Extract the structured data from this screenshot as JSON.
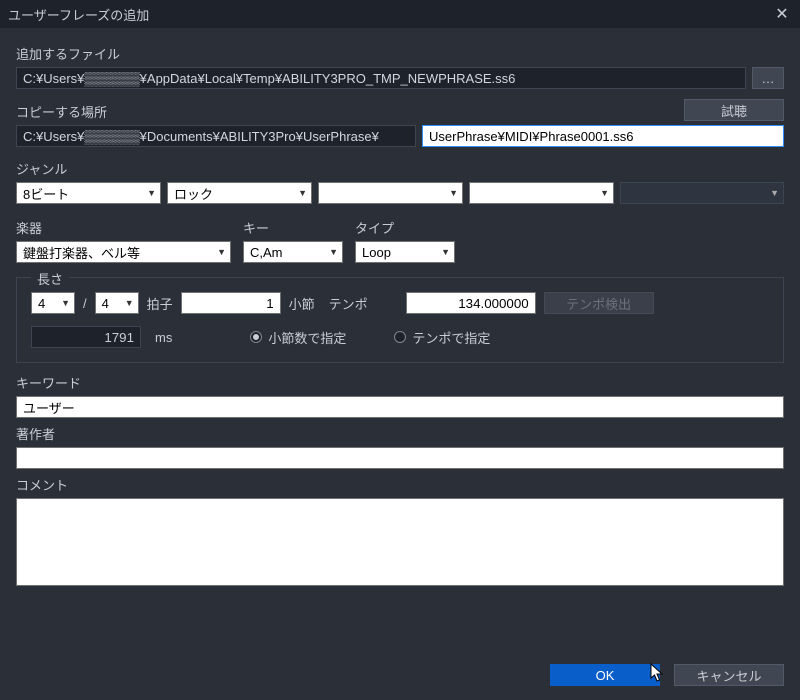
{
  "window": {
    "title": "ユーザーフレーズの追加"
  },
  "file_add": {
    "label": "追加するファイル",
    "path": "C:¥Users¥▒▒▒▒▒▒¥AppData¥Local¥Temp¥ABILITY3PRO_TMP_NEWPHRASE.ss6",
    "browse": "…"
  },
  "copy_to": {
    "label": "コピーする場所",
    "audition": "試聴",
    "base_path": "C:¥Users¥▒▒▒▒▒▒¥Documents¥ABILITY3Pro¥UserPhrase¥",
    "rel_path": "UserPhrase¥MIDI¥Phrase0001.ss6"
  },
  "genre": {
    "label": "ジャンル",
    "selects": [
      "8ビート",
      "ロック",
      "",
      "",
      ""
    ]
  },
  "instrument": {
    "label": "楽器",
    "value": "鍵盤打楽器、ベル等"
  },
  "key_field": {
    "label": "キー",
    "value": "C,Am"
  },
  "type_field": {
    "label": "タイプ",
    "value": "Loop"
  },
  "length": {
    "legend": "長さ",
    "beats1": "4",
    "slash": "/",
    "beats2": "4",
    "beat_label": "拍子",
    "bars": "1",
    "bar_label": "小節",
    "tempo_label": "テンポ",
    "tempo": "134.000000",
    "detect": "テンポ検出",
    "ms_value": "1791",
    "ms_label": "ms",
    "radio_bars": "小節数で指定",
    "radio_tempo": "テンポで指定"
  },
  "keyword": {
    "label": "キーワード",
    "value": "ユーザー"
  },
  "author": {
    "label": "著作者",
    "value": ""
  },
  "comment": {
    "label": "コメント",
    "value": ""
  },
  "footer": {
    "ok": "OK",
    "cancel": "キャンセル"
  }
}
